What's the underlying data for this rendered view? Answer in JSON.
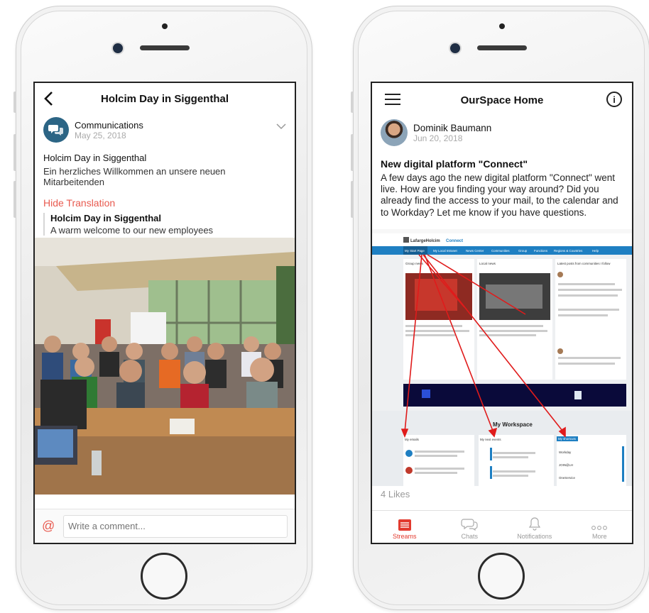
{
  "left": {
    "header_title": "Holcim Day in Siggenthal",
    "author": "Communications",
    "date": "May 25, 2018",
    "post_title": "Holcim Day in Siggenthal",
    "post_text": "Ein herzliches Willkommen an unsere neuen Mitarbeitenden",
    "hide_translation": "Hide Translation",
    "translated_title": "Holcim Day in Siggenthal",
    "translated_text": "A warm welcome to our new employees",
    "comment_placeholder": "Write a comment..."
  },
  "right": {
    "header_title": "OurSpace Home",
    "author": "Dominik Baumann",
    "date": "Jun 20, 2018",
    "post_title": "New digital platform \"Connect\"",
    "post_text": "A few days ago the new digital platform \"Connect\" went live. How are you finding your way around? Did you already find the access to your mail, to the calendar and to Workday? Let me know if you have questions.",
    "likes": "4 Likes",
    "tabs": [
      "Streams",
      "Chats",
      "Notifications",
      "More"
    ],
    "embedded": {
      "brand": "LafargeHolcim",
      "product": "Connect",
      "nav": [
        "My Start Page",
        "My Local Intranet",
        "News Center",
        "Communities",
        "Group",
        "Functions",
        "Regions & Countries",
        "Help"
      ],
      "group_news": "Group news",
      "local_news": "Local news",
      "latest_posts": "Latest posts from communities I follow",
      "workspace": "My Workspace",
      "my_emails": "My emails",
      "my_events": "My next events",
      "my_shortcuts": "My shortcuts",
      "shortcuts": [
        "Workday",
        "JOIN@LH",
        "OneService"
      ]
    }
  }
}
